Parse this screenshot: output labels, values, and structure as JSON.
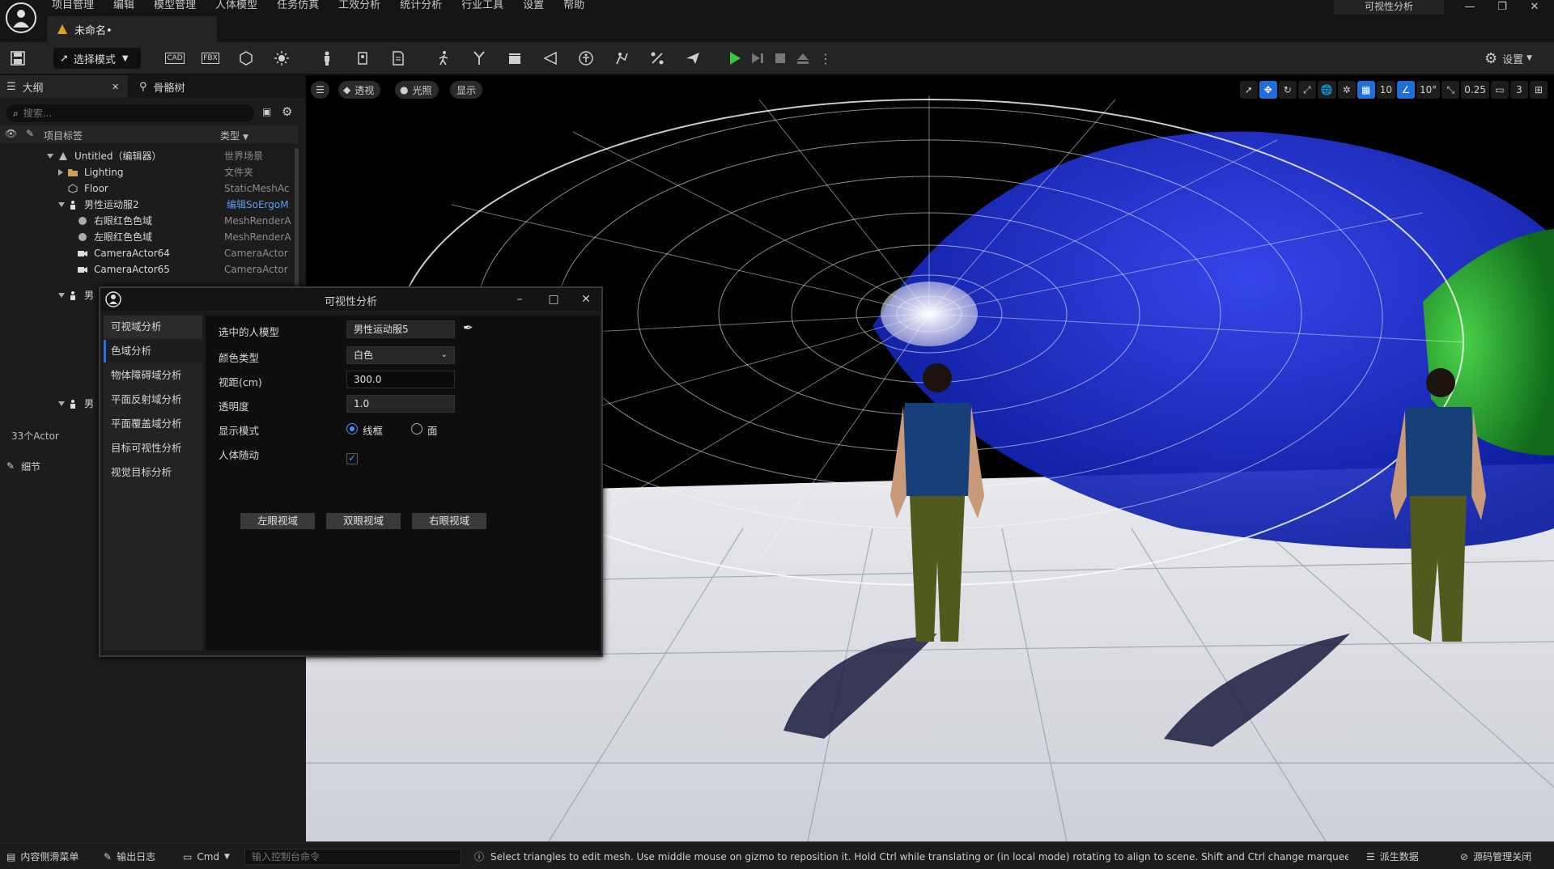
{
  "menu": {
    "items": [
      "项目管理",
      "编辑",
      "模型管理",
      "人体模型",
      "任务仿真",
      "工效分析",
      "统计分析",
      "行业工具",
      "设置",
      "帮助"
    ],
    "doc_tab": "未命名•",
    "window_title": "可视性分析"
  },
  "toolbar": {
    "mode_label": "选择模式",
    "settings_label": "设置",
    "cad_label": "CAD",
    "fbx_label": "FBX"
  },
  "outline": {
    "tabs": [
      "大纲",
      "骨骼树"
    ],
    "search_placeholder": "搜索...",
    "col_label": "项目标签",
    "col_type": "类型",
    "rows": [
      {
        "label": "Untitled（编辑器）",
        "type": "世界场景"
      },
      {
        "label": "Lighting",
        "type": "文件夹"
      },
      {
        "label": "Floor",
        "type": "StaticMeshAc"
      },
      {
        "label": "男性运动服2",
        "type": "编辑SoErgoM"
      },
      {
        "label": "右眼红色色域",
        "type": "MeshRenderA"
      },
      {
        "label": "左眼红色色域",
        "type": "MeshRenderA"
      },
      {
        "label": "CameraActor64",
        "type": "CameraActor"
      },
      {
        "label": "CameraActor65",
        "type": "CameraActor"
      }
    ],
    "partial_group_label": "男",
    "actor_count": "33个Actor",
    "details_label": "细节"
  },
  "viewport": {
    "perspective_label": "透视",
    "lighting_label": "光照",
    "show_label": "显示",
    "grid_snap": "10",
    "rot_snap": "10°",
    "scale_snap": "0.25",
    "camera_speed": "3"
  },
  "dialog": {
    "title": "可视性分析",
    "side_items": [
      "可视域分析",
      "色域分析",
      "物体障碍域分析",
      "平面反射域分析",
      "平面覆盖域分析",
      "目标可视性分析",
      "视觉目标分析"
    ],
    "fields": {
      "model_label": "选中的人模型",
      "model_value": "男性运动服5",
      "color_type_label": "颜色类型",
      "color_type_value": "白色",
      "view_distance_label": "视距(cm)",
      "view_distance_value": "300.0",
      "opacity_label": "透明度",
      "opacity_value": "1.0",
      "display_mode_label": "显示模式",
      "mode_wireframe": "线框",
      "mode_surface": "面",
      "follow_label": "人体随动"
    },
    "buttons": [
      "左眼视域",
      "双眼视域",
      "右眼视域"
    ]
  },
  "statusbar": {
    "content_drawer": "内容侧滑菜单",
    "output_log": "输出日志",
    "cmd_label": "Cmd",
    "cmd_placeholder": "输入控制台命令",
    "hint": "Select triangles to edit mesh. Use middle mouse on gizmo to reposition it. Hold Ctrl while translating or (in local mode) rotating to align to scene. Shift and Ctrl change marquee select beha",
    "derived_data": "派生数据",
    "source_control": "源码管理关闭"
  },
  "colors": {
    "accent": "#2b6fe0",
    "play_green": "#3ec43e",
    "blue_fov": "#1a2fd6",
    "green_fov": "#1a9a2a"
  }
}
